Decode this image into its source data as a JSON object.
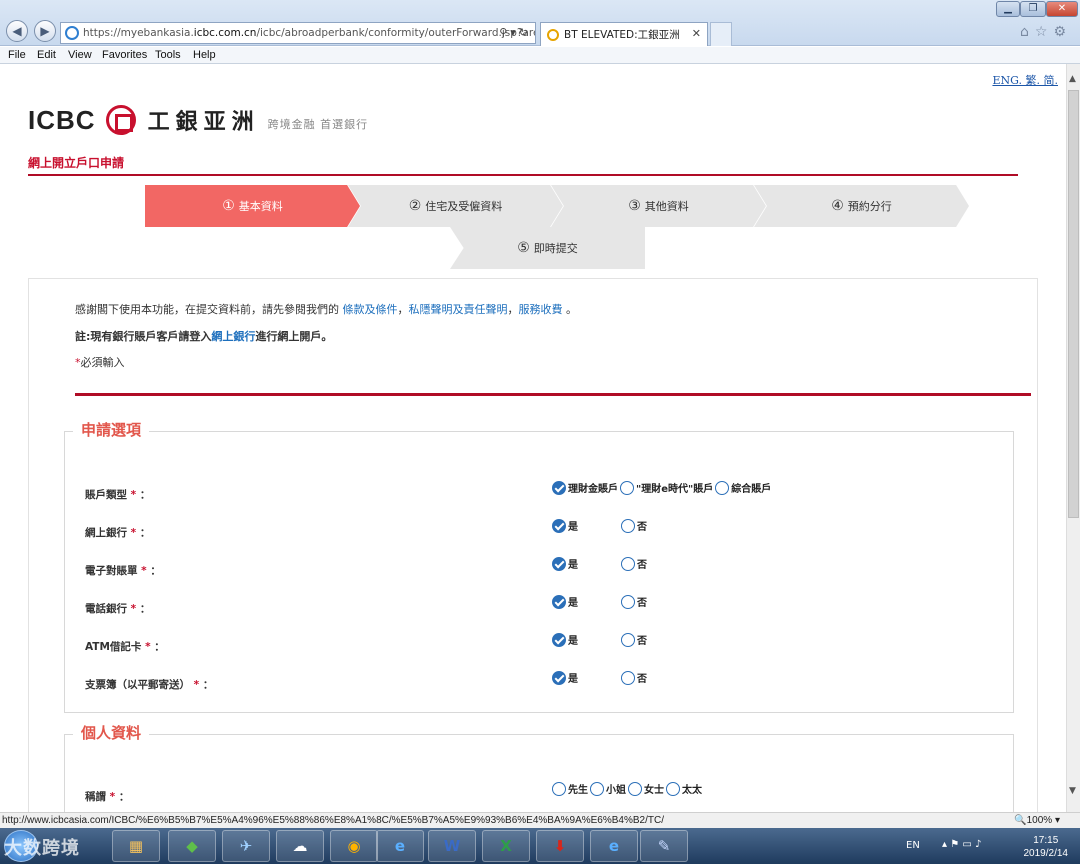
{
  "browser": {
    "url_prefix": "https://myebankasia.",
    "url_domain": "icbc.com.cn",
    "url_suffix": "/icbc/abroadperbank/conformity/outerForward.jsp?areaC",
    "tab_title": "BT ELEVATED:工銀亚洲",
    "menu": [
      "File",
      "Edit",
      "View",
      "Favorites",
      "Tools",
      "Help"
    ],
    "status_url": "http://www.icbcasia.com/ICBC/%E6%B5%B7%E5%A4%96%E5%88%86%E8%A1%8C/%E5%B7%A5%E9%93%B6%E4%BA%9A%E6%B4%B2/TC/",
    "zoom": "100%"
  },
  "header": {
    "lang_links": "ENG. 繁. 简.",
    "logo_text": "ICBC",
    "logo_cn": "工銀亚洲",
    "slogan": "跨境金融 首選銀行",
    "app_title": "網上開立戶口申請"
  },
  "steps": [
    {
      "num": "①",
      "label": "基本資料"
    },
    {
      "num": "②",
      "label": "住宅及受僱資料"
    },
    {
      "num": "③",
      "label": "其他資料"
    },
    {
      "num": "④",
      "label": "預約分行"
    },
    {
      "num": "⑤",
      "label": "即時提交"
    }
  ],
  "intro": {
    "line1_prefix": "感謝閣下使用本功能，在提交資料前，請先參閱我們的",
    "terms": "條款及條件",
    "privacy": "私隱聲明及責任聲明",
    "fees": "服務收費",
    "line2_prefix": "註:現有銀行賬戶客戶請登入",
    "ebank": "網上銀行",
    "line2_suffix": "進行網上開戶。",
    "required_note": "必須輸入"
  },
  "section1": {
    "title": "申請選項",
    "rows": [
      {
        "label": "賬戶類型",
        "options": [
          "理財金賬戶",
          "\"理財e時代\"賬戶",
          "綜合賬戶"
        ]
      },
      {
        "label": "網上銀行",
        "options": [
          "是",
          "否"
        ]
      },
      {
        "label": "電子對賬單",
        "options": [
          "是",
          "否"
        ]
      },
      {
        "label": "電話銀行",
        "options": [
          "是",
          "否"
        ]
      },
      {
        "label": "ATM借記卡",
        "options": [
          "是",
          "否"
        ]
      },
      {
        "label": "支票簿（以平郵寄送）",
        "options": [
          "是",
          "否"
        ]
      }
    ]
  },
  "section2": {
    "title": "個人資料",
    "salutation_label": "稱謂",
    "salutation_options": [
      "先生",
      "小姐",
      "女士",
      "太太"
    ]
  },
  "taskbar": {
    "lang": "EN",
    "time": "17:15",
    "date": "2019/2/14",
    "watermark": "大数跨境"
  }
}
